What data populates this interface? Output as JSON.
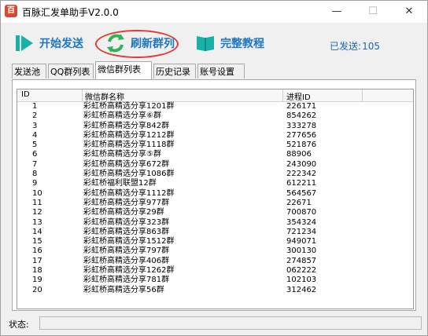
{
  "window": {
    "title": "百脉汇发单助手V2.0.0",
    "logo_text": "百",
    "minimize": "—",
    "maximize": "☐",
    "close": "✕"
  },
  "toolbar": {
    "start_label": "开始发送",
    "refresh_label": "刷新群列",
    "tutorial_label": "完整教程",
    "sent_label": "已发送:",
    "sent_count": "105",
    "accent": "#1d77c4",
    "ring_color": "#e53935"
  },
  "tabs": [
    "发送池",
    "QQ群列表",
    "微信群列表",
    "历史记录",
    "账号设置"
  ],
  "table": {
    "headers": {
      "id": "ID",
      "name": "微信群名称",
      "pid": "进程ID"
    },
    "rows": [
      {
        "id": "1",
        "name": "彩虹桥高精选分享1201群",
        "pid": "226171"
      },
      {
        "id": "2",
        "name": "彩虹桥高精选分享⑥群",
        "pid": "854262"
      },
      {
        "id": "3",
        "name": "彩虹桥高精选分享842群",
        "pid": "333278"
      },
      {
        "id": "4",
        "name": "彩虹桥高精选分享1212群",
        "pid": "277656"
      },
      {
        "id": "5",
        "name": "彩虹桥高精选分享1118群",
        "pid": "521876"
      },
      {
        "id": "6",
        "name": "彩虹桥高精选分享⑤群",
        "pid": "88906"
      },
      {
        "id": "7",
        "name": "彩虹桥高精选分享672群",
        "pid": "243090"
      },
      {
        "id": "8",
        "name": "彩虹桥高精选分享1086群",
        "pid": "222342"
      },
      {
        "id": "9",
        "name": "彩虹桥福利联盟12群",
        "pid": "612211"
      },
      {
        "id": "10",
        "name": "彩虹桥高精选分享1112群",
        "pid": "564567"
      },
      {
        "id": "11",
        "name": "彩虹桥高精选分享977群",
        "pid": "22671"
      },
      {
        "id": "12",
        "name": "彩虹桥高精选分享29群",
        "pid": "700870"
      },
      {
        "id": "13",
        "name": "彩虹桥高精选分享323群",
        "pid": "354324"
      },
      {
        "id": "14",
        "name": "彩虹桥高精选分享863群",
        "pid": "721234"
      },
      {
        "id": "15",
        "name": "彩虹桥高精选分享1512群",
        "pid": "949071"
      },
      {
        "id": "16",
        "name": "彩虹桥高精选分享797群",
        "pid": "300130"
      },
      {
        "id": "17",
        "name": "彩虹桥高精选分享406群",
        "pid": "274857"
      },
      {
        "id": "18",
        "name": "彩虹桥高精选分享1262群",
        "pid": "062222"
      },
      {
        "id": "19",
        "name": "彩虹桥高精选分享781群",
        "pid": "102103"
      },
      {
        "id": "20",
        "name": "彩虹桥高精选分享56群",
        "pid": "312462"
      }
    ]
  },
  "status": {
    "label": "状态:",
    "value": ""
  }
}
